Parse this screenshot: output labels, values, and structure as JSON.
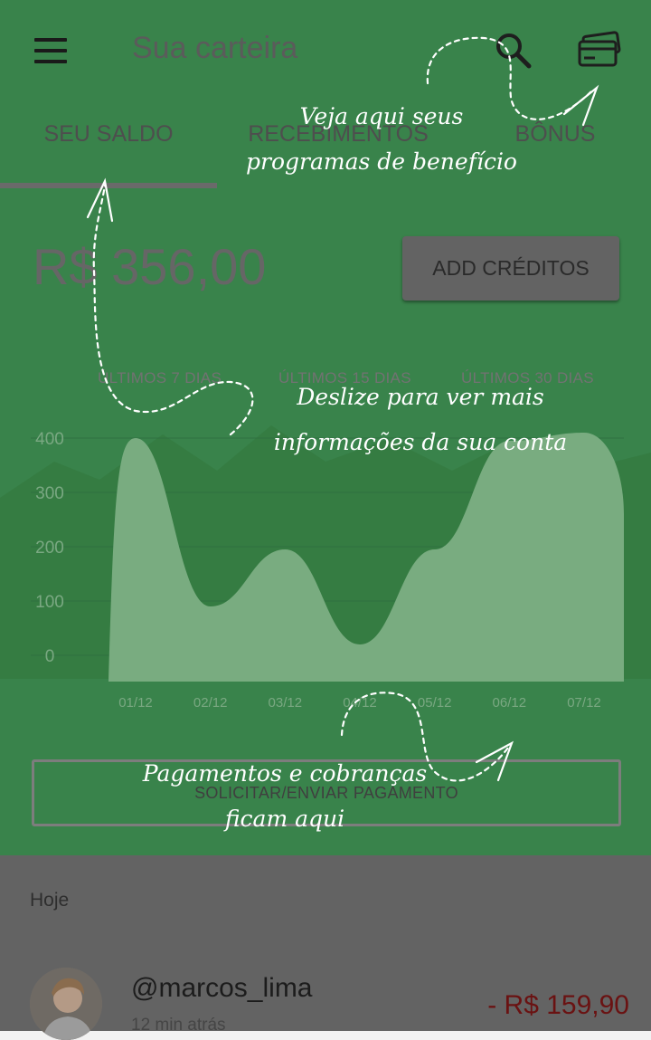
{
  "header": {
    "title": "Sua carteira",
    "menu_icon": "hamburger-menu-icon",
    "search_icon": "search-icon",
    "wallet_icon": "credit-card-icon"
  },
  "tabs": [
    {
      "label": "SEU SALDO",
      "active": true
    },
    {
      "label": "RECEBIMENTOS",
      "active": false
    },
    {
      "label": "BÔNUS",
      "active": false
    }
  ],
  "balance": {
    "value": "R$ 356,00",
    "add_button_label": "ADD CRÉDITOS"
  },
  "periods": [
    {
      "label": "ÚLTIMOS 7 DIAS",
      "active": true
    },
    {
      "label": "ÚLTIMOS 15 DIAS",
      "active": false
    },
    {
      "label": "ÚLTIMOS 30 DIAS",
      "active": false
    }
  ],
  "chart_data": {
    "type": "area",
    "x": [
      "01/12",
      "02/12",
      "03/12",
      "04/12",
      "05/12",
      "06/12",
      "07/12"
    ],
    "values": [
      400,
      90,
      195,
      20,
      195,
      395,
      410
    ],
    "y_ticks": [
      "400",
      "300",
      "200",
      "100",
      "0"
    ],
    "ylim": [
      0,
      400
    ],
    "grid": true
  },
  "payment_button_label": "SOLICITAR/ENVIAR PAGAMENTO",
  "transactions": {
    "section_label": "Hoje",
    "items": [
      {
        "user": "@marcos_lima",
        "time": "12 min atrás",
        "amount": "- R$ 159,90"
      }
    ]
  },
  "colors": {
    "brand_green": "#39834b",
    "negative_amount": "#6a1212"
  },
  "hints": {
    "benefits": [
      "Veja aqui seus",
      "programas de benefício"
    ],
    "swipe": [
      "Deslize para ver mais",
      "informações da sua conta"
    ],
    "payments": [
      "Pagamentos e cobranças",
      "ficam aqui"
    ]
  }
}
